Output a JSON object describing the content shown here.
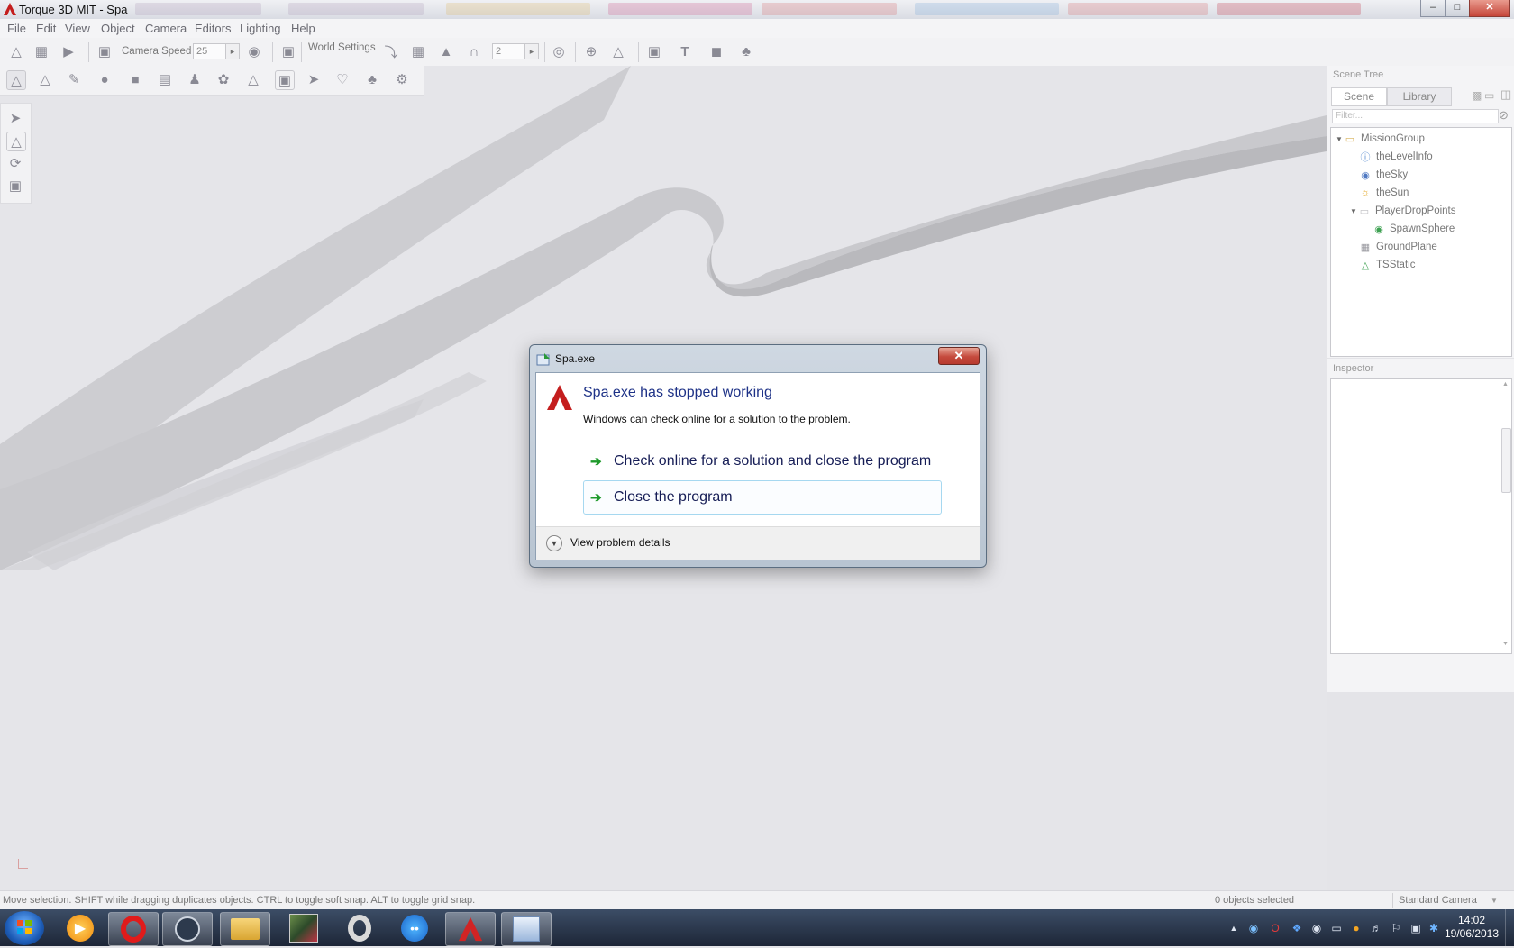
{
  "window": {
    "title": "Torque 3D MIT - Spa",
    "minimize_glyph": "–",
    "maximize_glyph": "□",
    "close_glyph": "✕"
  },
  "menu": {
    "items": [
      "File",
      "Edit",
      "View",
      "Object",
      "Camera",
      "Editors",
      "Lighting",
      "Help"
    ]
  },
  "toolbar": {
    "camera_speed_label": "Camera Speed",
    "camera_speed_value": "25",
    "world_settings_label": "World Settings",
    "snap_value": "2"
  },
  "scene_tree": {
    "panel_title": "Scene Tree",
    "tabs": [
      "Scene",
      "Library"
    ],
    "filter_placeholder": "Filter...",
    "items": [
      "MissionGroup",
      "theLevelInfo",
      "theSky",
      "theSun",
      "PlayerDropPoints",
      "SpawnSphere",
      "GroundPlane",
      "TSStatic"
    ]
  },
  "inspector": {
    "panel_title": "Inspector"
  },
  "status": {
    "message": "Move selection.  SHIFT while dragging duplicates objects.  CTRL to toggle soft snap.  ALT to toggle grid snap.",
    "selection": "0 objects selected",
    "camera": "Standard Camera"
  },
  "dialog": {
    "title": "Spa.exe",
    "heading": "Spa.exe has stopped working",
    "message": "Windows can check online for a solution to the problem.",
    "option_check": "Check online for a solution and close the program",
    "option_close": "Close the program",
    "details": "View problem details",
    "close_glyph": "✕"
  },
  "taskbar": {
    "time": "14:02",
    "date": "19/06/2013"
  },
  "colors": {
    "dialog_heading": "#1e3287",
    "option_arrow": "#1f9a2b",
    "taskbar": "#2a3850"
  }
}
